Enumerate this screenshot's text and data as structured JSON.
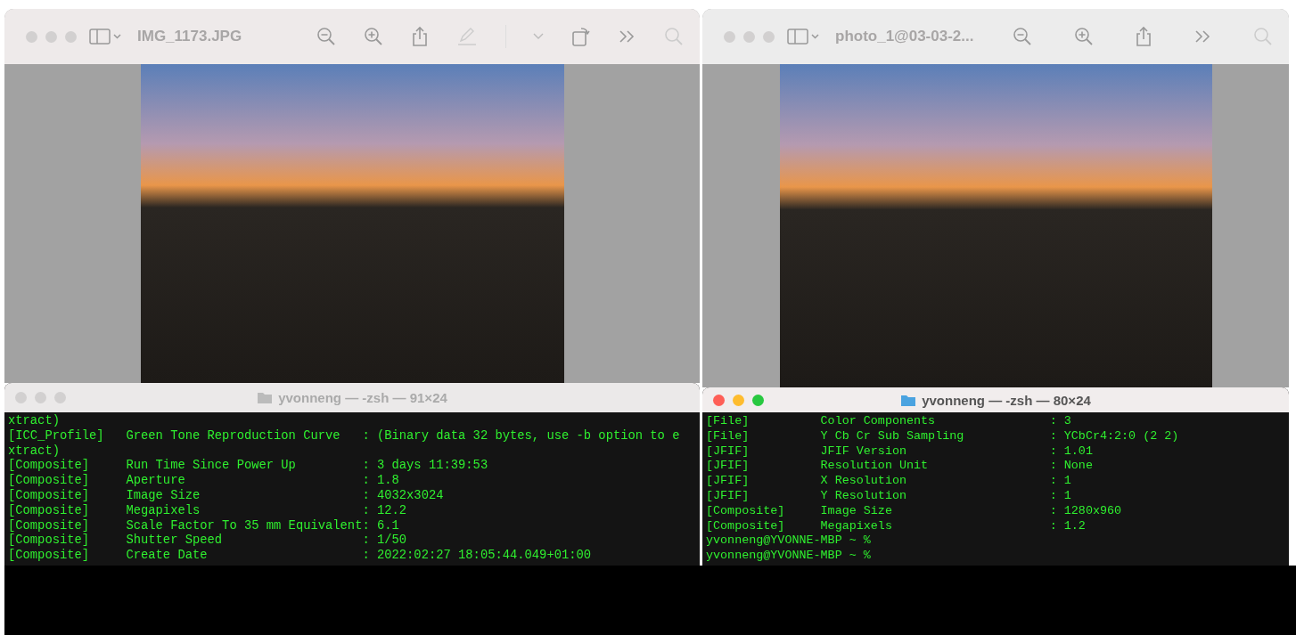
{
  "columns": [
    {
      "preview": {
        "title": "IMG_1173.JPG",
        "markup_tools": true
      },
      "terminal": {
        "title": "yvonneng — -zsh — 91×24",
        "active": false,
        "lines": [
          "xtract)",
          "[ICC_Profile]   Green Tone Reproduction Curve   : (Binary data 32 bytes, use -b option to e",
          "xtract)",
          "[Composite]     Run Time Since Power Up         : 3 days 11:39:53",
          "[Composite]     Aperture                        : 1.8",
          "[Composite]     Image Size                      : 4032x3024",
          "[Composite]     Megapixels                      : 12.2",
          "[Composite]     Scale Factor To 35 mm Equivalent: 6.1",
          "[Composite]     Shutter Speed                   : 1/50",
          "[Composite]     Create Date                     : 2022:02:27 18:05:44.049+01:00"
        ]
      }
    },
    {
      "preview": {
        "title": "photo_1@03-03-2...",
        "markup_tools": false
      },
      "terminal": {
        "title": "yvonneng — -zsh — 80×24",
        "active": true,
        "lines": [
          "[File]          Color Components                : 3",
          "[File]          Y Cb Cr Sub Sampling            : YCbCr4:2:0 (2 2)",
          "[JFIF]          JFIF Version                    : 1.01",
          "[JFIF]          Resolution Unit                 : None",
          "[JFIF]          X Resolution                    : 1",
          "[JFIF]          Y Resolution                    : 1",
          "[Composite]     Image Size                      : 1280x960",
          "[Composite]     Megapixels                      : 1.2",
          "yvonneng@YVONNE-MBP ~ %",
          "yvonneng@YVONNE-MBP ~ %"
        ]
      }
    }
  ]
}
